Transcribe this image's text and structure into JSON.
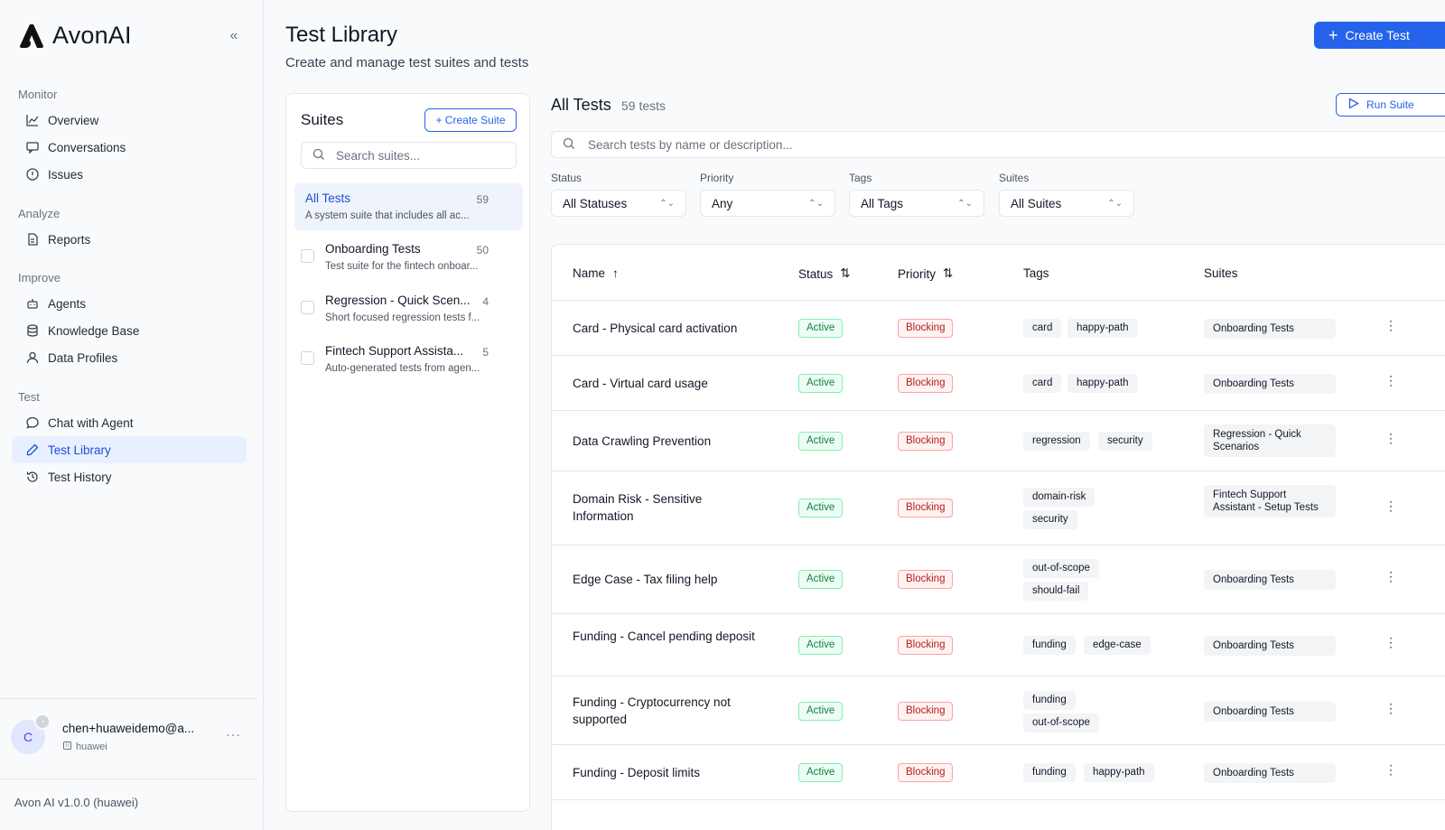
{
  "app": {
    "name": "AvonAI",
    "version": "Avon AI v1.0.0 (huawei)"
  },
  "sidebar": {
    "sections": [
      {
        "label": "Monitor",
        "items": [
          {
            "label": "Overview",
            "icon": "chart-line-icon"
          },
          {
            "label": "Conversations",
            "icon": "message-square-icon"
          },
          {
            "label": "Issues",
            "icon": "alert-circle-icon"
          }
        ]
      },
      {
        "label": "Analyze",
        "items": [
          {
            "label": "Reports",
            "icon": "file-icon"
          }
        ]
      },
      {
        "label": "Improve",
        "items": [
          {
            "label": "Agents",
            "icon": "bot-icon"
          },
          {
            "label": "Knowledge Base",
            "icon": "database-icon"
          },
          {
            "label": "Data Profiles",
            "icon": "user-icon"
          }
        ]
      },
      {
        "label": "Test",
        "items": [
          {
            "label": "Chat with Agent",
            "icon": "chat-bubble-icon"
          },
          {
            "label": "Test Library",
            "icon": "pencil-icon",
            "active": true
          },
          {
            "label": "Test History",
            "icon": "history-icon"
          }
        ]
      }
    ],
    "user": {
      "initial": "C",
      "email": "chen+huaweidemo@a...",
      "org": "huawei"
    }
  },
  "header": {
    "title": "Test Library",
    "subtitle": "Create and manage test suites and tests",
    "create_test_label": "Create Test"
  },
  "suites": {
    "title": "Suites",
    "create_label": "+ Create Suite",
    "search_placeholder": "Search suites...",
    "items": [
      {
        "name": "All Tests",
        "count": "59",
        "desc": "A system suite that includes all ac...",
        "active": true
      },
      {
        "name": "Onboarding Tests",
        "count": "50",
        "desc": "Test suite for the fintech onboar..."
      },
      {
        "name": "Regression - Quick Scen...",
        "count": "4",
        "desc": "Short focused regression tests f..."
      },
      {
        "name": "Fintech Support Assista...",
        "count": "5",
        "desc": "Auto-generated tests from agen..."
      }
    ]
  },
  "tests": {
    "title": "All Tests",
    "count_label": "59 tests",
    "run_suite_label": "Run Suite",
    "search_placeholder": "Search tests by name or description...",
    "filters": [
      {
        "label": "Status",
        "value": "All Statuses"
      },
      {
        "label": "Priority",
        "value": "Any"
      },
      {
        "label": "Tags",
        "value": "All Tags"
      },
      {
        "label": "Suites",
        "value": "All Suites"
      }
    ],
    "columns": {
      "name": "Name",
      "status": "Status",
      "priority": "Priority",
      "tags": "Tags",
      "suites": "Suites"
    },
    "rows": [
      {
        "name": "Card - Physical card activation",
        "status": "Active",
        "priority": "Blocking",
        "tags": [
          "card",
          "happy-path"
        ],
        "suite": "Onboarding Tests"
      },
      {
        "name": "Card - Virtual card usage",
        "status": "Active",
        "priority": "Blocking",
        "tags": [
          "card",
          "happy-path"
        ],
        "suite": "Onboarding Tests"
      },
      {
        "name": "Data Crawling Prevention",
        "status": "Active",
        "priority": "Blocking",
        "tags": [
          "regression",
          "security"
        ],
        "suite": "Regression - Quick Scenarios"
      },
      {
        "name": "Domain Risk - Sensitive Information",
        "status": "Active",
        "priority": "Blocking",
        "tags": [
          "domain-risk",
          "security"
        ],
        "suite": "Fintech Support Assistant - Setup Tests"
      },
      {
        "name": "Edge Case - Tax filing help",
        "status": "Active",
        "priority": "Blocking",
        "tags": [
          "out-of-scope",
          "should-fail"
        ],
        "suite": "Onboarding Tests"
      },
      {
        "name": "Funding - Cancel pending deposit",
        "status": "Active",
        "priority": "Blocking",
        "tags": [
          "funding",
          "edge-case"
        ],
        "suite": "Onboarding Tests"
      },
      {
        "name": "Funding - Cryptocurrency not supported",
        "status": "Active",
        "priority": "Blocking",
        "tags": [
          "funding",
          "out-of-scope"
        ],
        "suite": "Onboarding Tests"
      },
      {
        "name": "Funding - Deposit limits",
        "status": "Active",
        "priority": "Blocking",
        "tags": [
          "funding",
          "happy-path"
        ],
        "suite": "Onboarding Tests"
      }
    ]
  },
  "colors": {
    "accent": "#2563eb",
    "active_bg": "#e8efff",
    "status_active": "#15803d",
    "priority_blocking": "#b91c1c"
  }
}
